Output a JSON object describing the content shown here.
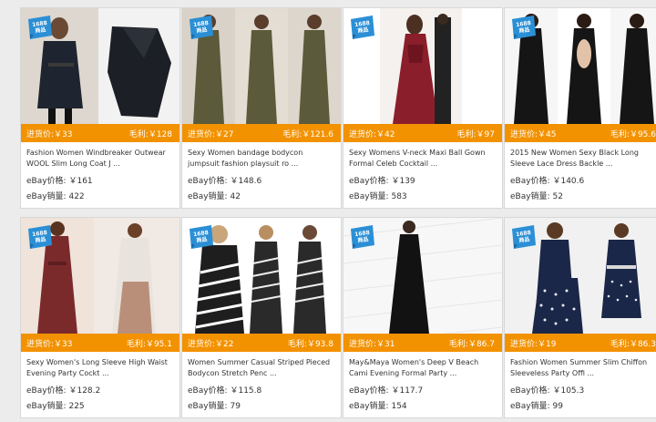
{
  "ribbon_text_top": "1688",
  "ribbon_text_bottom": "商品",
  "colors": {
    "accent": "#f39200",
    "ribbon": "#2b8fd6",
    "background": "#ececec"
  },
  "products": [
    {
      "cost_label": "进货价:",
      "cost": "￥33",
      "profit_label": "毛利:",
      "profit": "￥128",
      "title": "Fashion Women Windbreaker Outwear WOOL Slim Long Coat J ...",
      "ebay_price_label": "eBay价格:",
      "ebay_price": "￥161",
      "ebay_sales_label": "eBay销量:",
      "ebay_sales": "422",
      "image_icon": "black-wool-coat-photo"
    },
    {
      "cost_label": "进货价:",
      "cost": "￥27",
      "profit_label": "毛利:",
      "profit": "￥121.6",
      "title": "Sexy Women bandage bodycon jumpsuit fashion playsuit ro ...",
      "ebay_price_label": "eBay价格:",
      "ebay_price": "￥148.6",
      "ebay_sales_label": "eBay销量:",
      "ebay_sales": "42",
      "image_icon": "olive-jumpsuit-photo"
    },
    {
      "cost_label": "进货价:",
      "cost": "￥42",
      "profit_label": "毛利:",
      "profit": "￥97",
      "title": "Sexy Womens V-neck Maxi Ball Gown Formal Celeb Cocktail ...",
      "ebay_price_label": "eBay价格:",
      "ebay_price": "￥139",
      "ebay_sales_label": "eBay销量:",
      "ebay_sales": "583",
      "image_icon": "red-lace-gown-photo"
    },
    {
      "cost_label": "进货价:",
      "cost": "￥45",
      "profit_label": "毛利:",
      "profit": "￥95.6",
      "title": "2015 New Women Sexy Black Long Sleeve Lace Dress Backle ...",
      "ebay_price_label": "eBay价格:",
      "ebay_price": "￥140.6",
      "ebay_sales_label": "eBay销量:",
      "ebay_sales": "52",
      "image_icon": "black-lace-dress-photo"
    },
    {
      "cost_label": "进货价:",
      "cost": "￥33",
      "profit_label": "毛利:",
      "profit": "￥95.1",
      "title": "Sexy Women's Long Sleeve High Waist Evening Party Cockt ...",
      "ebay_price_label": "eBay价格:",
      "ebay_price": "￥128.2",
      "ebay_sales_label": "eBay销量:",
      "ebay_sales": "225",
      "image_icon": "burgundy-evening-dress-photo"
    },
    {
      "cost_label": "进货价:",
      "cost": "￥22",
      "profit_label": "毛利:",
      "profit": "￥93.8",
      "title": "Women Summer Casual Striped Pieced Bodycon Stretch Penc ...",
      "ebay_price_label": "eBay价格:",
      "ebay_price": "￥115.8",
      "ebay_sales_label": "eBay销量:",
      "ebay_sales": "79",
      "image_icon": "striped-bodycon-dress-photo"
    },
    {
      "cost_label": "进货价:",
      "cost": "￥31",
      "profit_label": "毛利:",
      "profit": "￥86.7",
      "title": "May&Maya Women's Deep V Beach Cami Evening Formal Party ...",
      "ebay_price_label": "eBay价格:",
      "ebay_price": "￥117.7",
      "ebay_sales_label": "eBay销量:",
      "ebay_sales": "154",
      "image_icon": "black-cami-maxi-dress-photo"
    },
    {
      "cost_label": "进货价:",
      "cost": "￥19",
      "profit_label": "毛利:",
      "profit": "￥86.3",
      "title": "Fashion Women Summer Slim Chiffon Sleeveless Party Offi ...",
      "ebay_price_label": "eBay价格:",
      "ebay_price": "￥105.3",
      "ebay_sales_label": "eBay销量:",
      "ebay_sales": "99",
      "image_icon": "navy-polka-dot-dress-photo"
    }
  ]
}
